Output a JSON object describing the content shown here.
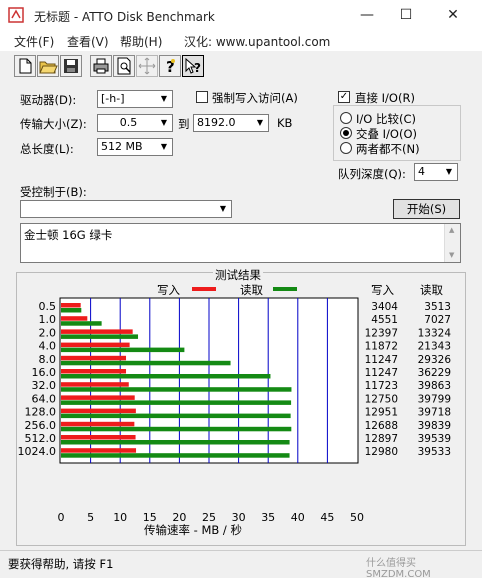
{
  "window": {
    "title": "无标题 - ATTO Disk Benchmark",
    "controls": [
      "—",
      "☐",
      "✕"
    ]
  },
  "menu": [
    "文件(F)",
    "查看(V)",
    "帮助(H)",
    "汉化: www.upantool.com"
  ],
  "toolbar": [
    "new-icon",
    "open-icon",
    "save-icon",
    "print-icon",
    "print-preview-icon",
    "move-icon",
    "help-icon",
    "context-help-icon"
  ],
  "form": {
    "drive_label": "驱动器(D):",
    "drive_value": "[-h-]",
    "transfer_label": "传输大小(Z):",
    "transfer_from": "0.5",
    "to_label": "到",
    "transfer_to": "8192.0",
    "kb_label": "KB",
    "length_label": "总长度(L):",
    "length_value": "512 MB",
    "force_write_label": "强制写入访问(A)",
    "direct_io_label": "直接 I/O(R)",
    "io_compare_label": "I/O 比较(C)",
    "overlap_io_label": "交叠 I/O(O)",
    "neither_label": "两者都不(N)",
    "queue_label": "队列深度(Q):",
    "queue_value": "4",
    "controlled_label": "受控制于(B):",
    "controlled_value": "",
    "start_button": "开始(S)",
    "description": "金士顿 16G 绿卡"
  },
  "chart_data": {
    "type": "bar",
    "title": "测试结果",
    "legend_write": "写入",
    "legend_read": "读取",
    "col_write": "写入",
    "col_read": "读取",
    "xlabel": "传输速率 - MB / 秒",
    "xlim": [
      0,
      50
    ],
    "xticks": [
      "0",
      "5",
      "10",
      "15",
      "20",
      "25",
      "30",
      "35",
      "40",
      "45",
      "50"
    ],
    "categories": [
      "0.5",
      "1.0",
      "2.0",
      "4.0",
      "8.0",
      "16.0",
      "32.0",
      "64.0",
      "128.0",
      "256.0",
      "512.0",
      "1024.0"
    ],
    "series": [
      {
        "name": "写入",
        "color": "#ee1c1c",
        "values": [
          3404,
          4551,
          12397,
          11872,
          11247,
          11247,
          11723,
          12750,
          12951,
          12688,
          12897,
          12980
        ]
      },
      {
        "name": "读取",
        "color": "#148a14",
        "values": [
          3513,
          7027,
          13324,
          21343,
          29326,
          36229,
          39863,
          39799,
          39718,
          39839,
          39539,
          39533
        ]
      }
    ]
  },
  "status": "要获得帮助, 请按 F1",
  "watermark": "什么值得买 SMZDM.COM"
}
